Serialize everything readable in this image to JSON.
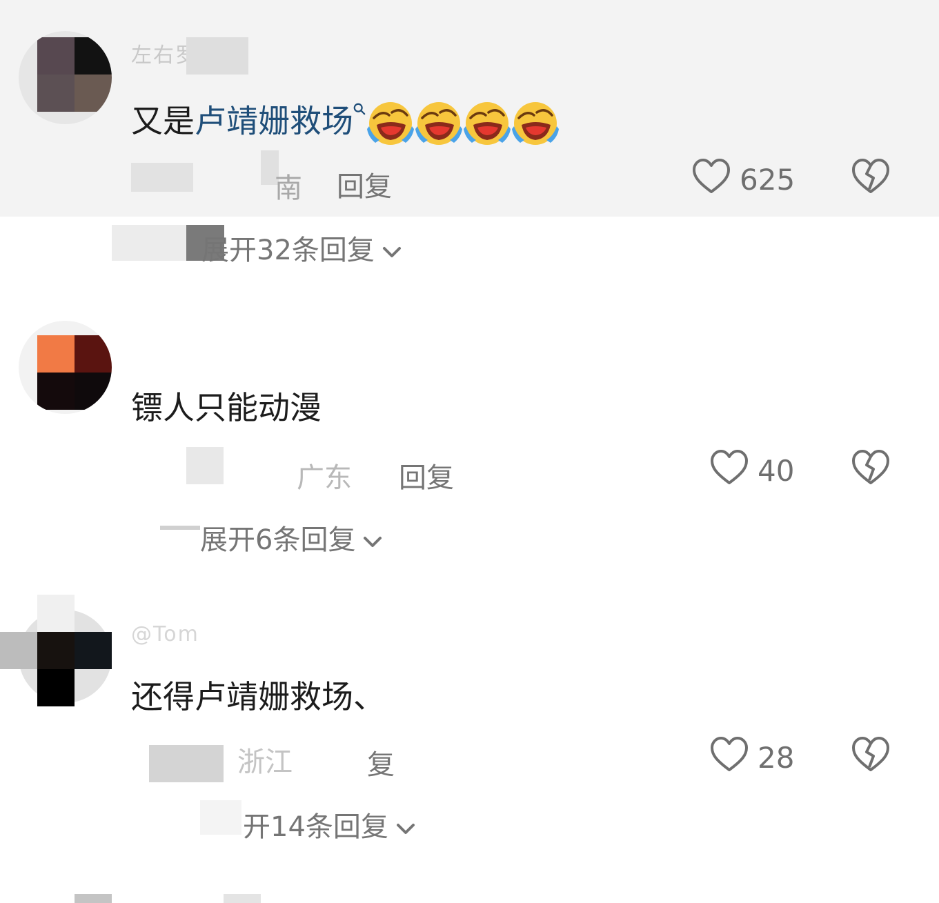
{
  "comments": [
    {
      "username": "左右罗",
      "body_prefix": "又是",
      "body_link": "卢靖姗救场",
      "emoji": [
        "laughing-crying-emoji",
        "laughing-crying-emoji",
        "laughing-crying-emoji",
        "laughing-crying-emoji"
      ],
      "meta_location": "南",
      "reply_label": "回复",
      "likes": "625",
      "expand_label": "展开32条回复"
    },
    {
      "body": "镖人只能动漫",
      "meta_location": "广东",
      "reply_label": "回复",
      "likes": "40",
      "expand_label": "展开6条回复"
    },
    {
      "username": "@Tom",
      "body": "还得卢靖姗救场、",
      "meta_location": "浙江",
      "reply_label": "复",
      "likes": "28",
      "expand_label": "开14条回复"
    }
  ],
  "colors": {
    "highlight_bg": "#f3f3f3",
    "link": "#1f4e79",
    "text": "#1c1c1c",
    "meta": "#a8a8a8",
    "action": "#757575"
  },
  "icons": {
    "like": "heart-outline-icon",
    "dislike": "broken-heart-icon",
    "expand": "chevron-down-icon",
    "search": "search-mini-icon"
  }
}
